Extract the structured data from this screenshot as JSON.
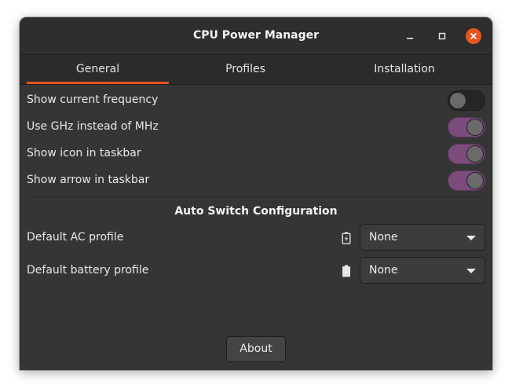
{
  "window": {
    "title": "CPU Power Manager"
  },
  "tabs": [
    {
      "label": "General",
      "active": true
    },
    {
      "label": "Profiles",
      "active": false
    },
    {
      "label": "Installation",
      "active": false
    }
  ],
  "settings": [
    {
      "label": "Show current frequency",
      "enabled": false
    },
    {
      "label": "Use GHz instead of MHz",
      "enabled": true
    },
    {
      "label": "Show icon in taskbar",
      "enabled": true
    },
    {
      "label": "Show arrow in taskbar",
      "enabled": true
    }
  ],
  "auto_switch": {
    "title": "Auto Switch Configuration",
    "ac": {
      "label": "Default AC profile",
      "icon": "battery-charging-icon",
      "value": "None"
    },
    "battery": {
      "label": "Default battery profile",
      "icon": "battery-icon",
      "value": "None"
    }
  },
  "footer": {
    "about_label": "About"
  },
  "colors": {
    "accent": "#e95420",
    "switch_on": "#7c4d7c",
    "close_button": "#e9541f"
  }
}
